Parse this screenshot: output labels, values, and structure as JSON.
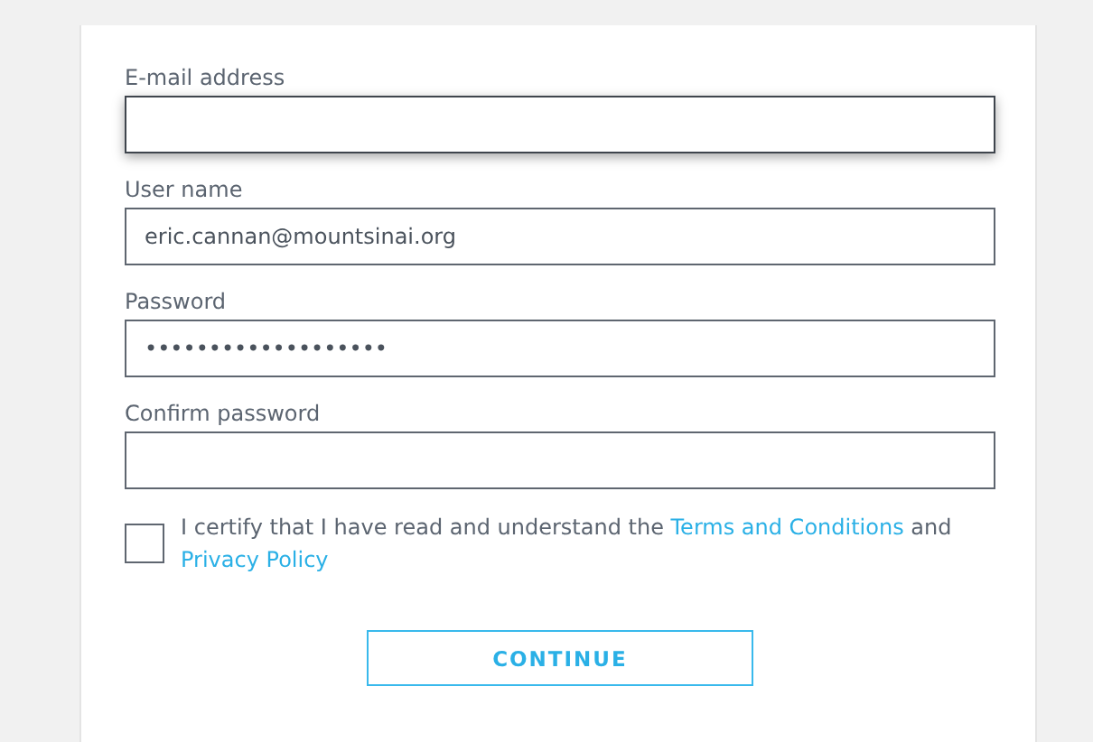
{
  "fields": [
    {
      "label": "E-mail address",
      "focused": true
    },
    {
      "label": "User name",
      "value": "eric.cannan@mountsinai.org",
      "focused": false
    },
    {
      "label": "Password",
      "value": "•••••••••••••••••••",
      "focused": false
    },
    {
      "label": "Confirm password",
      "focused": false
    }
  ],
  "agreement": {
    "checked": false,
    "parts": [
      {
        "kind": "text",
        "text": "I certify that I have read and understand the "
      },
      {
        "kind": "link",
        "text": "Terms and Conditions"
      },
      {
        "kind": "text",
        "text": " and "
      },
      {
        "kind": "link",
        "text": "Privacy Policy"
      }
    ]
  },
  "continue_button": "CONTINUE"
}
